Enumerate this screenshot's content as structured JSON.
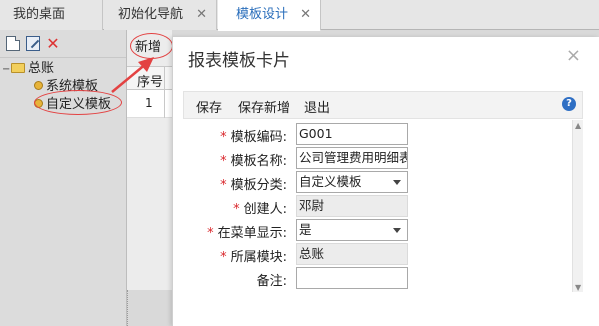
{
  "tabs": [
    {
      "label": "我的桌面",
      "closable": false
    },
    {
      "label": "初始化导航",
      "closable": true
    },
    {
      "label": "模板设计",
      "closable": true,
      "active": true
    }
  ],
  "tab_close_glyph": "✕",
  "left_toolbar": {
    "icons": [
      "new-document-icon",
      "edit-icon",
      "delete-icon"
    ],
    "delete_glyph": "✕"
  },
  "tree": {
    "root": {
      "label": "总账",
      "expander": "−"
    },
    "children": [
      {
        "label": "系统模板"
      },
      {
        "label": "自定义模板",
        "highlighted": true
      }
    ]
  },
  "grid": {
    "add_button": "新增",
    "seq_header": "序号",
    "rows": [
      "1"
    ]
  },
  "dialog": {
    "title": "报表模板卡片",
    "close_glyph": "×",
    "toolbar": {
      "save": "保存",
      "save_new": "保存新增",
      "exit": "退出",
      "help_glyph": "?"
    },
    "fields": [
      {
        "label": "模板编码:",
        "required": true,
        "value": "G001",
        "type": "text"
      },
      {
        "label": "模板名称:",
        "required": true,
        "value": "公司管理费用明细表",
        "type": "text"
      },
      {
        "label": "模板分类:",
        "required": true,
        "value": "自定义模板",
        "type": "select"
      },
      {
        "label": "创建人:",
        "required": true,
        "value": "邓尉",
        "type": "readonly"
      },
      {
        "label": "在菜单显示:",
        "required": true,
        "value": "是",
        "type": "select"
      },
      {
        "label": "所属模块:",
        "required": true,
        "value": "总账",
        "type": "readonly"
      },
      {
        "label": "备注:",
        "required": false,
        "value": "",
        "type": "text"
      }
    ],
    "required_mark": "*"
  },
  "colors": {
    "accent": "#2a6ebb",
    "required": "#d9262b",
    "annotation": "#e34242"
  }
}
